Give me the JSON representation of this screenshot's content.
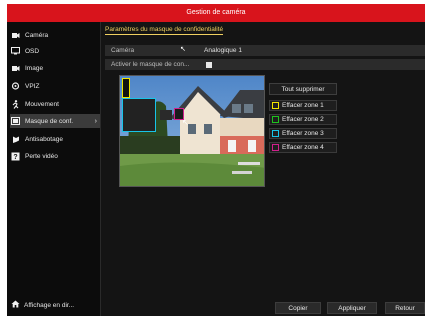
{
  "window": {
    "title": "Gestion de caméra"
  },
  "sidebar": {
    "items": [
      {
        "label": "Caméra",
        "icon": "camera-icon"
      },
      {
        "label": "OSD",
        "icon": "display-icon"
      },
      {
        "label": "Image",
        "icon": "image-icon"
      },
      {
        "label": "VPIZ",
        "icon": "ptz-icon"
      },
      {
        "label": "Mouvement",
        "icon": "motion-icon"
      },
      {
        "label": "Masque de conf.",
        "icon": "privacy-mask-icon"
      },
      {
        "label": "Antisabotage",
        "icon": "tamper-icon"
      },
      {
        "label": "Perte vidéo",
        "icon": "video-loss-icon"
      }
    ],
    "active_index": 5,
    "bottom": {
      "label": "Affichage en dir...",
      "icon": "home-icon"
    }
  },
  "main": {
    "tab_title": "Paramètres du masque de confidentialité",
    "camera_label": "Caméra",
    "camera_value": "Analogique 1",
    "enable_label": "Activer le masque de con...",
    "enable_checked": true
  },
  "zones": {
    "clear_all": "Tout supprimer",
    "items": [
      {
        "label": "Effacer zone 1",
        "color": "#f2e600"
      },
      {
        "label": "Effacer zone 2",
        "color": "#1ec41e"
      },
      {
        "label": "Effacer zone 3",
        "color": "#18c4e8"
      },
      {
        "label": "Effacer zone 4",
        "color": "#d0208c"
      }
    ]
  },
  "footer": {
    "copy": "Copier",
    "apply": "Appliquer",
    "back": "Retour"
  }
}
